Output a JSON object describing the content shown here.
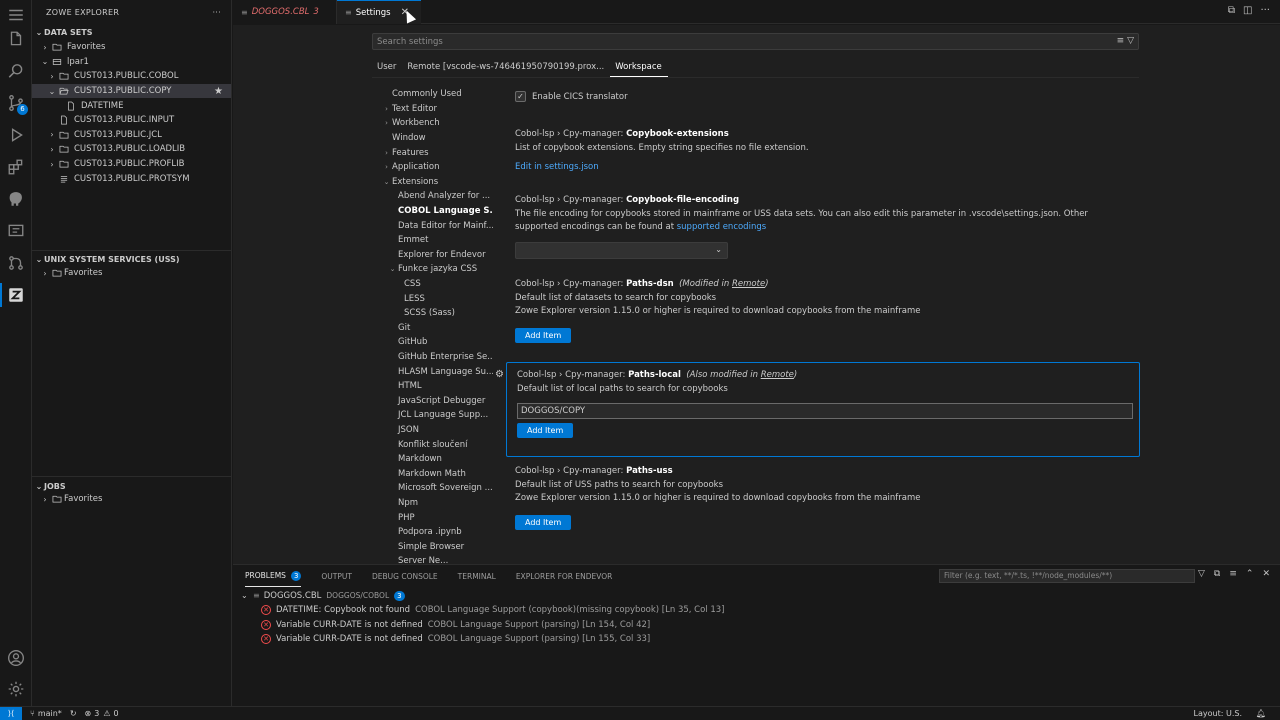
{
  "activity_bar": {
    "items": [
      "explorer-icon",
      "search-icon",
      "source-control-icon",
      "run-debug-icon",
      "extensions-icon",
      "zowe-icon",
      "remote-icon",
      "git-graph-icon",
      "zowe-explorer-icon"
    ],
    "scm_badge": "6",
    "bottom": [
      "account-icon",
      "manage-gear-icon"
    ]
  },
  "sidebar": {
    "title": "ZOWE EXPLORER",
    "more": "···",
    "datasets": {
      "header": "DATA SETS",
      "items": [
        {
          "label": "Favorites",
          "level": 1,
          "chevron": "›",
          "icon": "folder-star"
        },
        {
          "label": "lpar1",
          "level": 1,
          "chevron": "⌄",
          "icon": "profile"
        },
        {
          "label": "CUST013.PUBLIC.COBOL",
          "level": 2,
          "chevron": "›",
          "icon": "folder"
        },
        {
          "label": "CUST013.PUBLIC.COPY",
          "level": 2,
          "chevron": "⌄",
          "icon": "folder-open"
        },
        {
          "label": "DATETIME",
          "level": 3,
          "chevron": "",
          "icon": "file"
        },
        {
          "label": "CUST013.PUBLIC.INPUT",
          "level": 2,
          "chevron": "",
          "icon": "file"
        },
        {
          "label": "CUST013.PUBLIC.JCL",
          "level": 2,
          "chevron": "›",
          "icon": "folder"
        },
        {
          "label": "CUST013.PUBLIC.LOADLIB",
          "level": 2,
          "chevron": "›",
          "icon": "folder"
        },
        {
          "label": "CUST013.PUBLIC.PROFLIB",
          "level": 2,
          "chevron": "›",
          "icon": "folder"
        },
        {
          "label": "CUST013.PUBLIC.PROTSYM",
          "level": 2,
          "chevron": "",
          "icon": "file-lines"
        }
      ]
    },
    "uss": {
      "header": "UNIX SYSTEM SERVICES (USS)",
      "items": [
        "Favorites"
      ]
    },
    "jobs": {
      "header": "JOBS",
      "items": [
        "Favorites"
      ]
    }
  },
  "tabs": [
    {
      "label": "DOGGOS.CBL",
      "problems": "3"
    },
    {
      "label": "Settings"
    }
  ],
  "settings": {
    "search_placeholder": "Search settings",
    "scopes": [
      "User",
      "Remote [vscode-ws-746461950790199.prox...",
      "Workspace"
    ],
    "toc": [
      {
        "label": "Commonly Used",
        "chev": ""
      },
      {
        "label": "Text Editor",
        "chev": "›"
      },
      {
        "label": "Workbench",
        "chev": "›"
      },
      {
        "label": "Window",
        "chev": ""
      },
      {
        "label": "Features",
        "chev": "›"
      },
      {
        "label": "Application",
        "chev": "›"
      },
      {
        "label": "Extensions",
        "chev": "⌄"
      },
      {
        "label": "Abend Analyzer for ...",
        "indent": 1
      },
      {
        "label": "COBOL Language S...",
        "indent": 1,
        "bold": true
      },
      {
        "label": "Data Editor for Mainf...",
        "indent": 1
      },
      {
        "label": "Emmet",
        "indent": 1
      },
      {
        "label": "Explorer for Endevor",
        "indent": 1
      },
      {
        "label": "Funkce jazyka CSS",
        "indent": 1,
        "chev": "⌄"
      },
      {
        "label": "CSS",
        "indent": 2
      },
      {
        "label": "LESS",
        "indent": 2
      },
      {
        "label": "SCSS (Sass)",
        "indent": 2
      },
      {
        "label": "Git",
        "indent": 1
      },
      {
        "label": "GitHub",
        "indent": 1
      },
      {
        "label": "GitHub Enterprise Se...",
        "indent": 1
      },
      {
        "label": "HLASM Language Su...",
        "indent": 1
      },
      {
        "label": "HTML",
        "indent": 1
      },
      {
        "label": "JavaScript Debugger",
        "indent": 1
      },
      {
        "label": "JCL Language Supp...",
        "indent": 1
      },
      {
        "label": "JSON",
        "indent": 1
      },
      {
        "label": "Konflikt sloučení",
        "indent": 1
      },
      {
        "label": "Markdown",
        "indent": 1
      },
      {
        "label": "Markdown Math",
        "indent": 1
      },
      {
        "label": "Microsoft Sovereign ...",
        "indent": 1
      },
      {
        "label": "Npm",
        "indent": 1
      },
      {
        "label": "PHP",
        "indent": 1
      },
      {
        "label": "Podpora .ipynb",
        "indent": 1
      },
      {
        "label": "Simple Browser",
        "indent": 1
      },
      {
        "label": "Server Ne...",
        "indent": 1
      }
    ],
    "cics": {
      "label": "Enable CICS translator",
      "checked": true
    },
    "copybook_extensions": {
      "prefix": "Cobol-lsp › Cpy-manager: ",
      "name": "Copybook-extensions",
      "desc": "List of copybook extensions. Empty string specifies no file extension.",
      "link": "Edit in settings.json"
    },
    "copybook_encoding": {
      "prefix": "Cobol-lsp › Cpy-manager: ",
      "name": "Copybook-file-encoding",
      "desc": "The file encoding for copybooks stored in mainframe or USS data sets. You can also edit this parameter in .vscode\\settings.json. Other supported encodings can be found at ",
      "link": "supported encodings"
    },
    "paths_dsn": {
      "prefix": "Cobol-lsp › Cpy-manager: ",
      "name": "Paths-dsn",
      "mod_pre": "(Modified in ",
      "mod_link": "Remote",
      "mod_post": ")",
      "desc1": "Default list of datasets to search for copybooks",
      "desc2": "Zowe Explorer version 1.15.0 or higher is required to download copybooks from the mainframe",
      "button": "Add Item"
    },
    "paths_local": {
      "prefix": "Cobol-lsp › Cpy-manager: ",
      "name": "Paths-local",
      "mod_pre": "(Also modified in ",
      "mod_link": "Remote",
      "mod_post": ")",
      "desc": "Default list of local paths to search for copybooks",
      "value": "DOGGOS/COPY",
      "button": "Add Item"
    },
    "paths_uss": {
      "prefix": "Cobol-lsp › Cpy-manager: ",
      "name": "Paths-uss",
      "desc1": "Default list of USS paths to search for copybooks",
      "desc2": "Zowe Explorer version 1.15.0 or higher is required to download copybooks from the mainframe",
      "button": "Add Item"
    }
  },
  "panel": {
    "tabs": [
      "PROBLEMS",
      "OUTPUT",
      "DEBUG CONSOLE",
      "TERMINAL",
      "EXPLORER FOR ENDEVOR"
    ],
    "problems_count": "3",
    "filter_placeholder": "Filter (e.g. text, **/*.ts, !**/node_modules/**)",
    "file": {
      "name": "DOGGOS.CBL",
      "path": "DOGGOS/COBOL",
      "count": "3"
    },
    "problems": [
      {
        "msg": "DATETIME: Copybook not found",
        "src": "COBOL Language Support (copybook)(missing copybook)  [Ln 35, Col 13]"
      },
      {
        "msg": "Variable CURR-DATE is not defined",
        "src": "COBOL Language Support (parsing)  [Ln 154, Col 42]"
      },
      {
        "msg": "Variable CURR-DATE is not defined",
        "src": "COBOL Language Support (parsing)  [Ln 155, Col 33]"
      }
    ]
  },
  "statusbar": {
    "branch": "main*",
    "errors": "3",
    "warnings": "0",
    "layout": "Layout: U.S."
  },
  "colors": {
    "accent": "#0078d4",
    "error": "#f14c4c",
    "link": "#4daafc",
    "modified_tab": "#e06c6c"
  }
}
